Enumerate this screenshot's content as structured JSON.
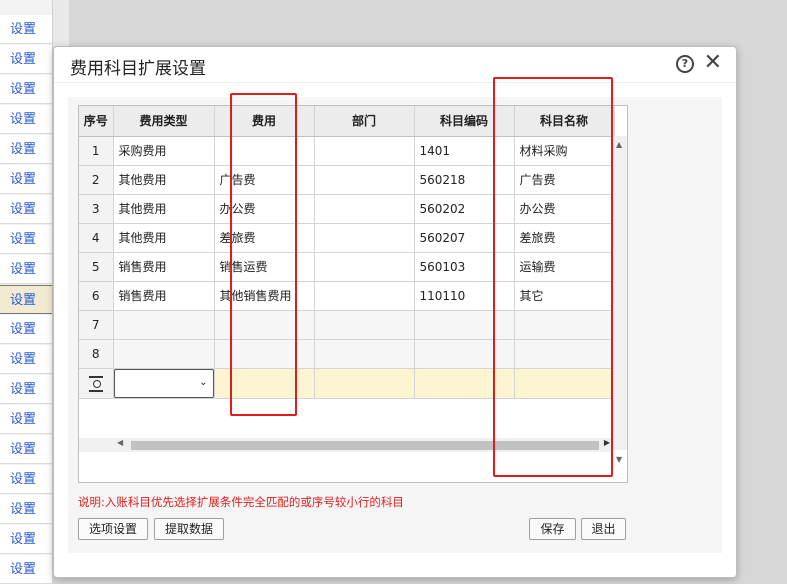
{
  "left_panel": {
    "label": "设置",
    "count": 19,
    "active_index": 9
  },
  "dialog": {
    "title": "费用科目扩展设置",
    "help_glyph": "?",
    "close_glyph": "✕"
  },
  "table": {
    "columns": [
      "序号",
      "费用类型",
      "费用",
      "部门",
      "科目编码",
      "科目名称"
    ],
    "rows": [
      {
        "idx": "1",
        "type": "采购费用",
        "fee": "",
        "dept": "",
        "code": "1401",
        "name": "材料采购"
      },
      {
        "idx": "2",
        "type": "其他费用",
        "fee": "广告费",
        "dept": "",
        "code": "560218",
        "name": "广告费"
      },
      {
        "idx": "3",
        "type": "其他费用",
        "fee": "办公费",
        "dept": "",
        "code": "560202",
        "name": "办公费"
      },
      {
        "idx": "4",
        "type": "其他费用",
        "fee": "差旅费",
        "dept": "",
        "code": "560207",
        "name": "差旅费"
      },
      {
        "idx": "5",
        "type": "销售费用",
        "fee": "销售运费",
        "dept": "",
        "code": "560103",
        "name": "运输费"
      },
      {
        "idx": "6",
        "type": "销售费用",
        "fee": "其他销售费用",
        "dept": "",
        "code": "110110",
        "name": "其它"
      },
      {
        "idx": "7",
        "type": "",
        "fee": "",
        "dept": "",
        "code": "",
        "name": ""
      },
      {
        "idx": "8",
        "type": "",
        "fee": "",
        "dept": "",
        "code": "",
        "name": ""
      }
    ],
    "new_row_select_value": ""
  },
  "note": "说明:入账科目优先选择扩展条件完全匹配的或序号较小行的科目",
  "buttons": {
    "options": "选项设置",
    "fetch": "提取数据",
    "save": "保存",
    "exit": "退出"
  },
  "colors": {
    "highlight_box": "#e21b1b",
    "note": "#e02020",
    "link": "#2a5bd7",
    "new_row": "#fdf5d1"
  }
}
